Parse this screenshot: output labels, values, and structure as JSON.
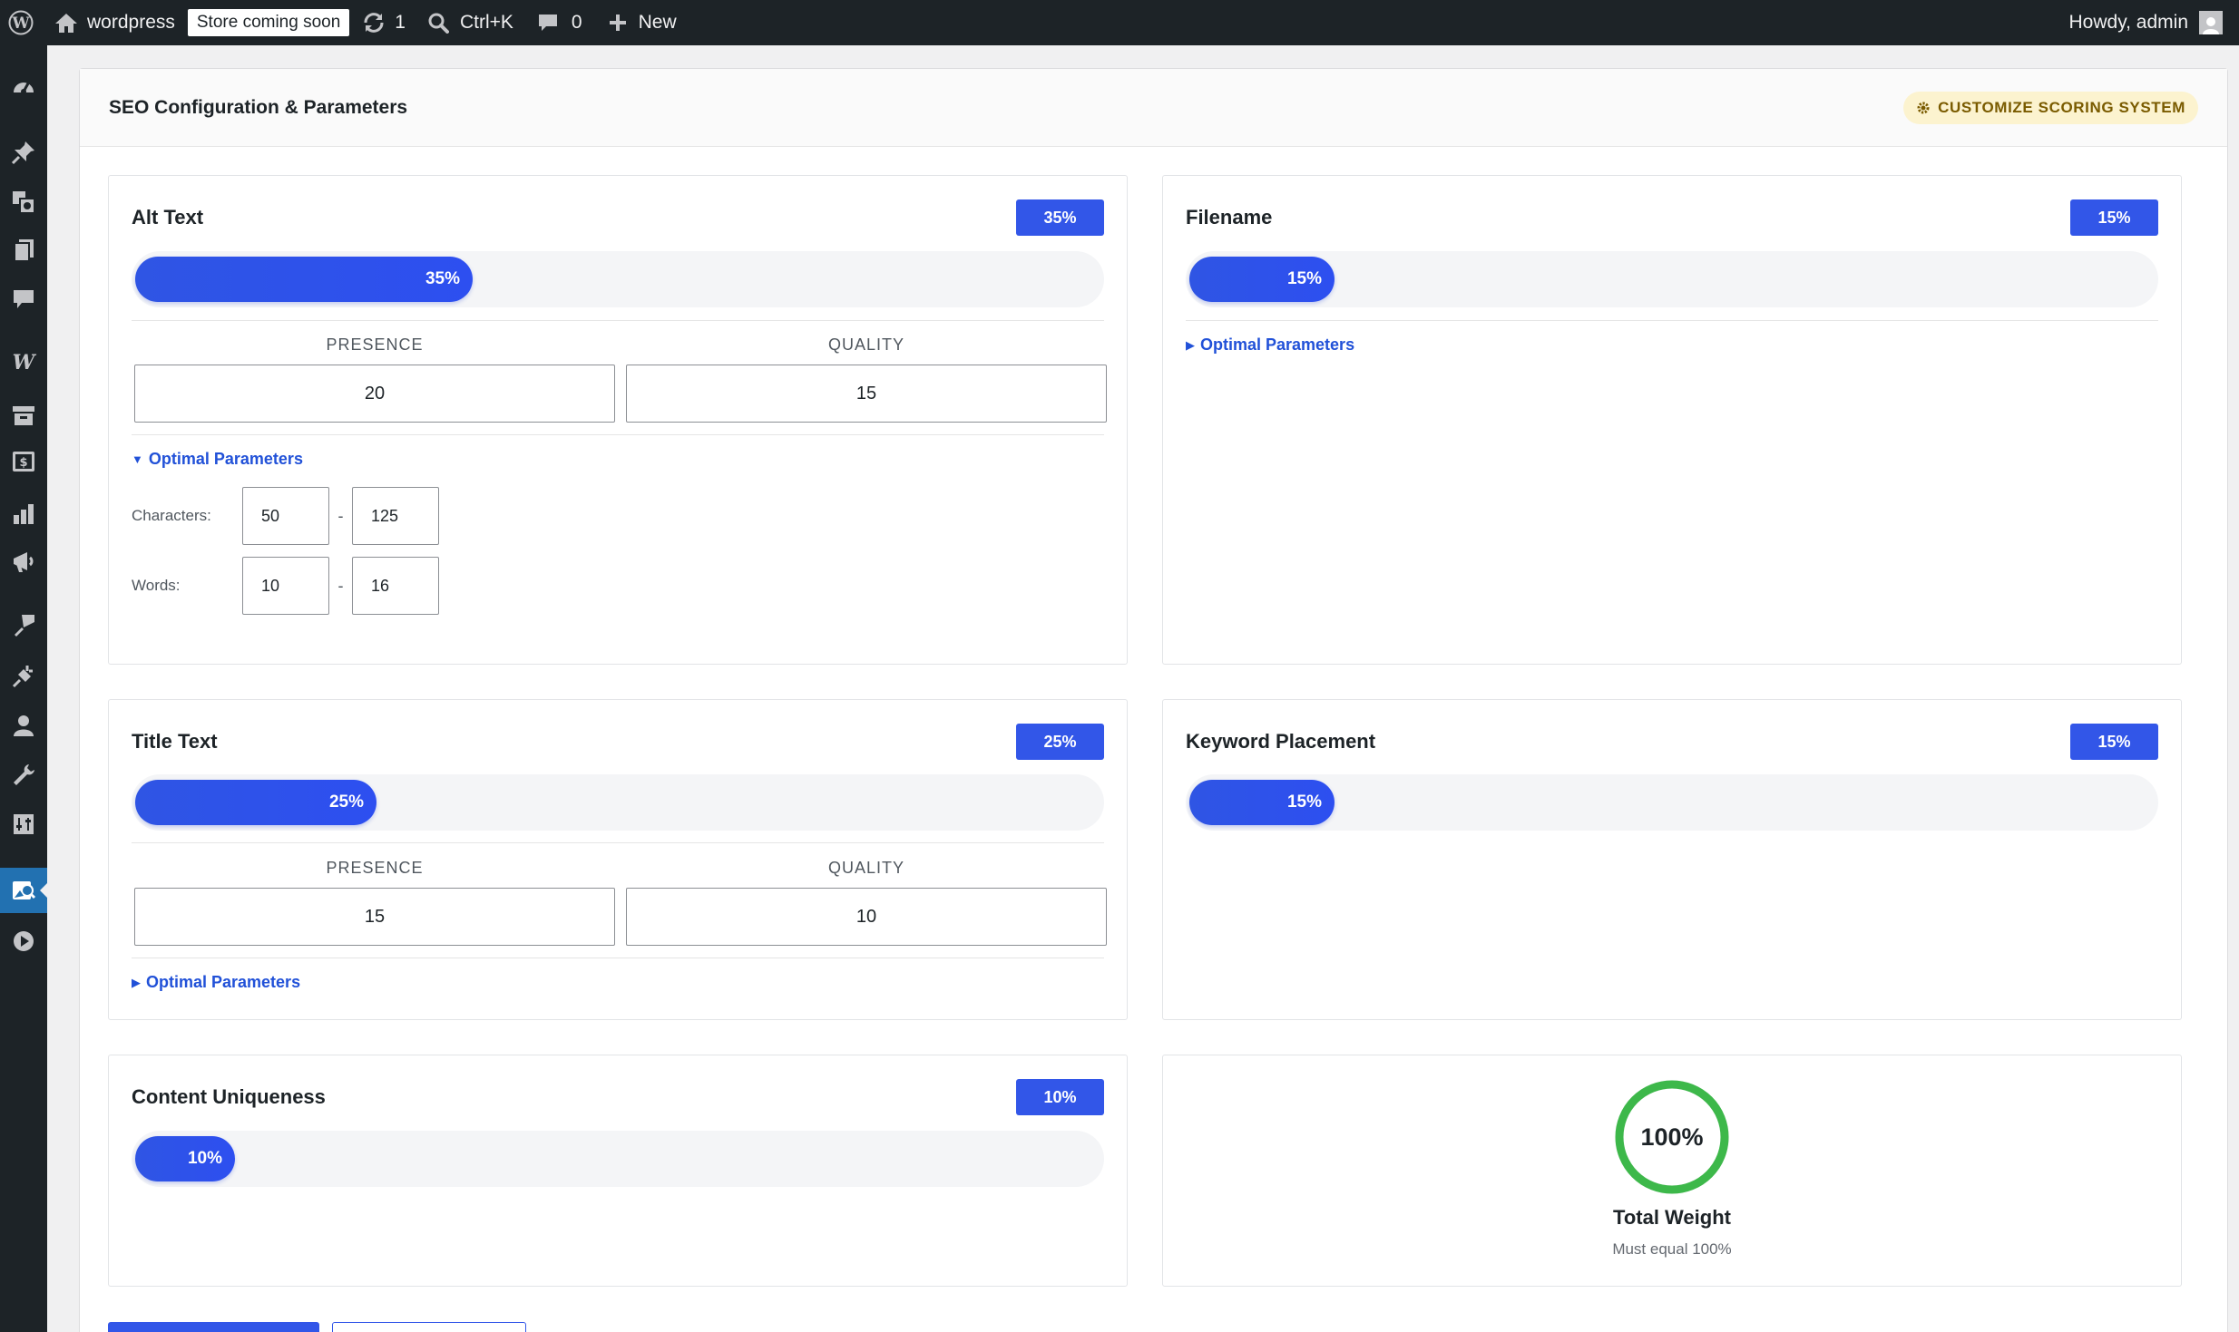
{
  "adminbar": {
    "site_name": "wordpress",
    "store_badge": "Store coming soon",
    "updates_count": "1",
    "search_shortcut": "Ctrl+K",
    "comments_count": "0",
    "new_label": "New",
    "greeting": "Howdy, admin"
  },
  "sidebar": {
    "items": [
      "dashboard-icon",
      "pin-icon",
      "media-icon",
      "pages-icon",
      "comments-icon",
      "woocommerce-icon",
      "products-icon",
      "payments-icon",
      "analytics-icon",
      "marketing-icon",
      "appearance-icon",
      "plugins-icon",
      "users-icon",
      "tools-icon",
      "settings-icon",
      "image-seo-icon",
      "media-play-icon"
    ],
    "active": "image-seo-icon"
  },
  "page": {
    "title": "SEO Configuration & Parameters",
    "customize_label": "CUSTOMIZE SCORING SYSTEM"
  },
  "cards": {
    "alt_text": {
      "title": "Alt Text",
      "badge": "35%",
      "fill_label": "35%",
      "fill_fraction": 0.35,
      "presence_label": "PRESENCE",
      "presence_value": "20",
      "quality_label": "QUALITY",
      "quality_value": "15",
      "optimal_label": "Optimal Parameters",
      "optimal_expanded": true,
      "characters_label": "Characters:",
      "characters_min": "50",
      "characters_max": "125",
      "words_label": "Words:",
      "words_min": "10",
      "words_max": "16",
      "dash": "-"
    },
    "filename": {
      "title": "Filename",
      "badge": "15%",
      "fill_label": "15%",
      "fill_fraction": 0.15,
      "optimal_label": "Optimal Parameters",
      "optimal_expanded": false
    },
    "title_text": {
      "title": "Title Text",
      "badge": "25%",
      "fill_label": "25%",
      "fill_fraction": 0.25,
      "presence_label": "PRESENCE",
      "presence_value": "15",
      "quality_label": "QUALITY",
      "quality_value": "10",
      "optimal_label": "Optimal Parameters",
      "optimal_expanded": false
    },
    "keyword_placement": {
      "title": "Keyword Placement",
      "badge": "15%",
      "fill_label": "15%",
      "fill_fraction": 0.15
    },
    "content_uniqueness": {
      "title": "Content Uniqueness",
      "badge": "10%",
      "fill_label": "10%",
      "fill_fraction": 0.1
    },
    "total": {
      "value": "100%",
      "title": "Total Weight",
      "subtitle": "Must equal 100%",
      "fraction": 1.0
    }
  },
  "colors": {
    "accent": "#3256e8",
    "ring": "#3db84a",
    "adminbar": "#1d2327",
    "link": "#2151d8",
    "customize_bg": "#fcf3cf",
    "customize_fg": "#7a5b00"
  }
}
